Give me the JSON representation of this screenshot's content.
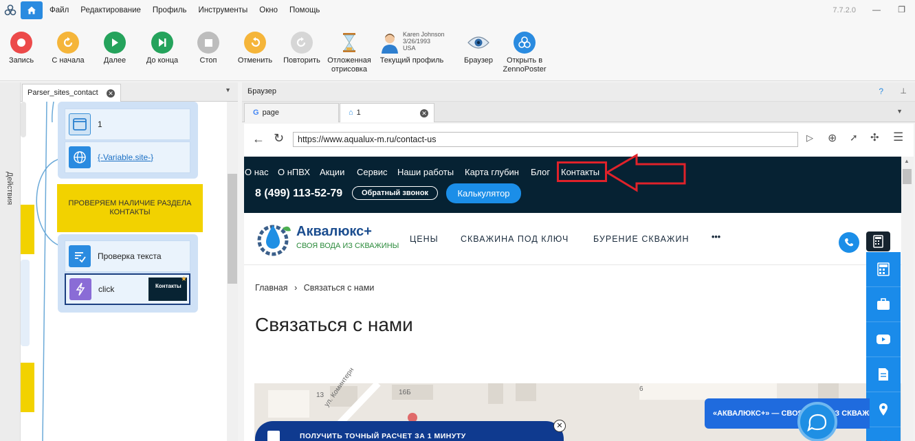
{
  "menubar": {
    "items": [
      "Файл",
      "Редактирование",
      "Профиль",
      "Инструменты",
      "Окно",
      "Помощь"
    ],
    "version": "7.7.2.0"
  },
  "toolbar": {
    "record": "Запись",
    "restart": "С начала",
    "next": "Далее",
    "to_end": "До конца",
    "stop": "Стоп",
    "undo": "Отменить",
    "redo": "Повторить",
    "deferred_render": "Отложенная отрисовка",
    "current_profile": "Текущий профиль",
    "browser": "Браузер",
    "open_in": "Открыть в ZennoPoster",
    "profile_name": "Karen Johnson",
    "profile_date": "3/26/1993",
    "profile_country": "USA"
  },
  "side_tab": "Действия",
  "project": {
    "tab_name": "Parser_sites_contact",
    "nodes": {
      "window_label": "1",
      "nav_label": "{-Variable.site-}",
      "check_section": "ПРОВЕРЯЕМ НАЛИЧИЕ РАЗДЕЛА КОНТАКТЫ",
      "text_check": "Проверка текста",
      "click": "click",
      "click_thumb": "Контакты"
    }
  },
  "browser": {
    "panel_title": "Браузер",
    "help": "?",
    "tabs": [
      {
        "label": "page"
      },
      {
        "label": "1"
      }
    ],
    "url": "https://www.aqualux-m.ru/contact-us"
  },
  "site": {
    "top_nav": [
      "О нас",
      "О нПВХ",
      "Акции",
      "Сервис",
      "Наши работы",
      "Карта глубин",
      "Блог",
      "Контакты"
    ],
    "phone": "8 (499) 113-52-79",
    "callback": "Обратный звонок",
    "calculator": "Калькулятор",
    "brand": "Аквалюкс+",
    "brand_sub": "СВОЯ ВОДА ИЗ СКВАЖИНЫ",
    "header_nav": [
      "ЦЕНЫ",
      "СКВАЖИНА ПОД КЛЮЧ",
      "БУРЕНИЕ СКВАЖИН"
    ],
    "more": "•••",
    "breadcrumb_home": "Главная",
    "breadcrumb_sep": "›",
    "breadcrumb_current": "Связаться с нами",
    "heading": "Связаться с нами",
    "map_labels": [
      "13",
      "16Б",
      "6",
      "ул. Коминтерн"
    ],
    "promo": "ПОЛУЧИТЬ ТОЧНЫЙ РАСЧЕТ ЗА 1 МИНУТУ",
    "chat_banner": "«АКВАЛЮКС+» — СВОЯ ВОДА ИЗ СКВАЖИНЫ"
  },
  "colors": {
    "accent": "#2a8be0",
    "site_dark": "#062233",
    "highlight_red": "#e0222a",
    "site_blue": "#1a8bea",
    "yellow": "#f2d200"
  }
}
